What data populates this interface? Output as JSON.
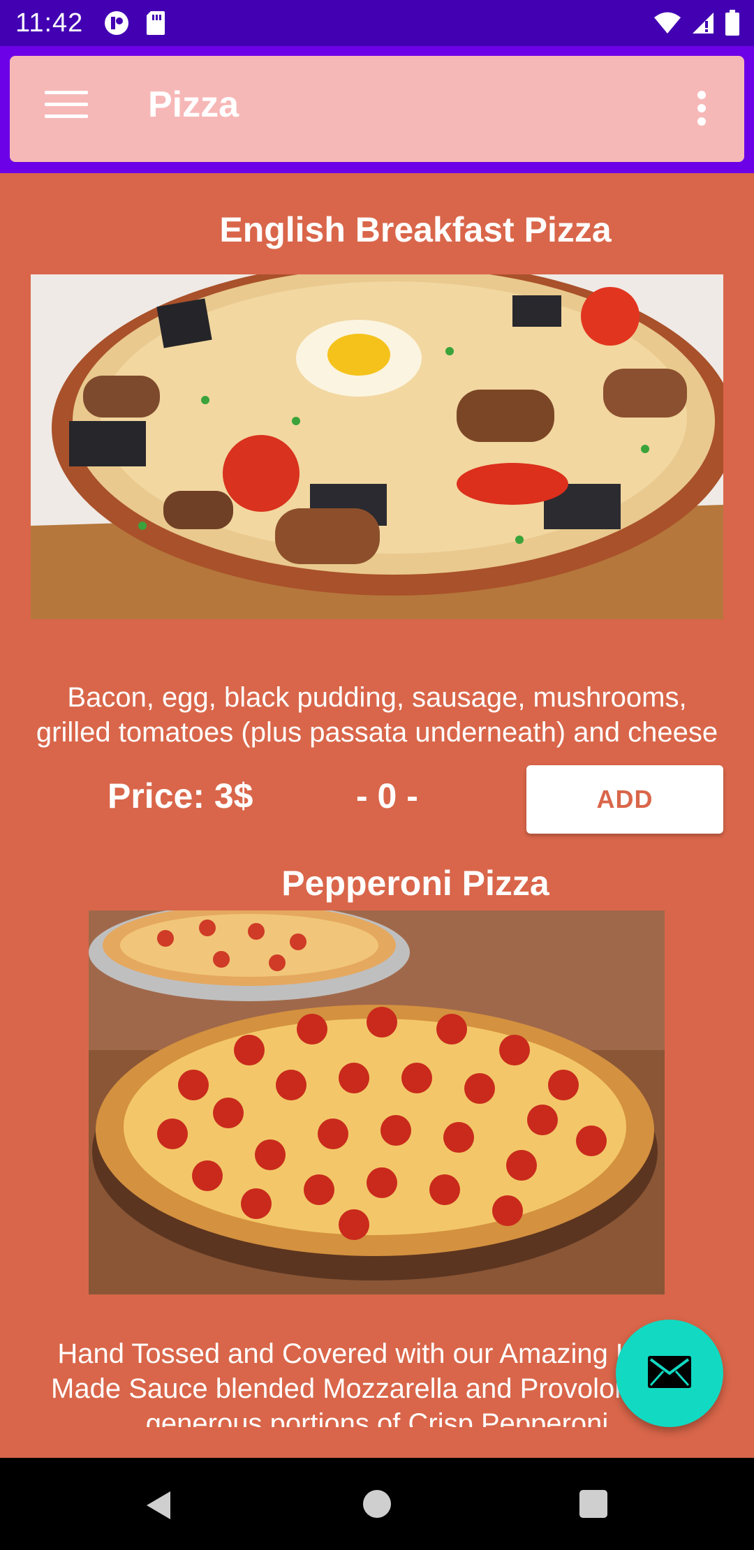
{
  "status_bar": {
    "time": "11:42"
  },
  "toolbar": {
    "title": "Pizza",
    "menu_icon": "menu-icon",
    "overflow_icon": "more-vert-icon"
  },
  "items": [
    {
      "title": "English Breakfast Pizza",
      "description_line1": "Bacon, egg, black pudding, sausage, mushrooms,",
      "description_line2": "grilled tomatoes (plus passata underneath) and cheese",
      "price": "Price: 3$",
      "quantity": "- 0 -",
      "add_label": "ADD"
    },
    {
      "title": "Pepperoni Pizza",
      "description_line1": "Hand Tossed and Covered with our Amazing House",
      "description_line2": "Made Sauce blended Mozzarella and Provolone with",
      "description_line3": "generous portions of Crisp Pepperoni"
    }
  ],
  "fab": {
    "icon": "email-icon",
    "color": "#12d9c2"
  },
  "colors": {
    "background": "#d9664a",
    "toolbar": "#f6b8b7",
    "status_bar": "#4300b3",
    "app_bar": "#6c00e6"
  }
}
